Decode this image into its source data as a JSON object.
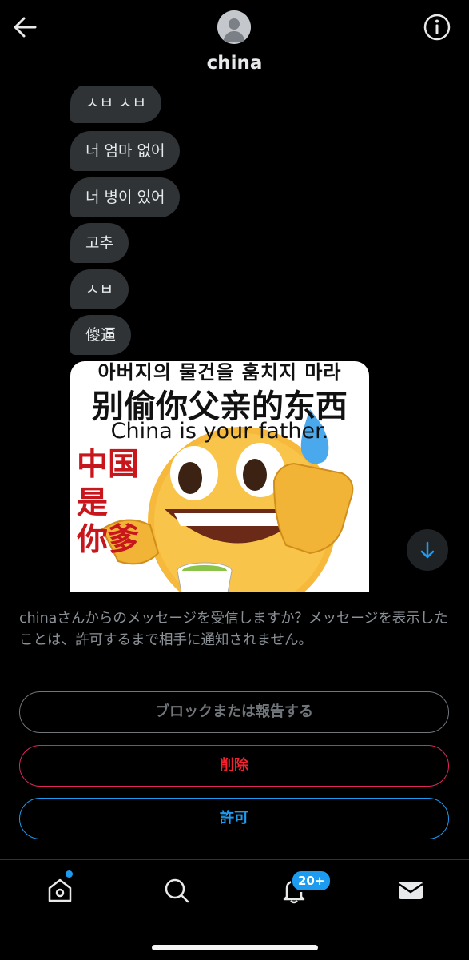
{
  "header": {
    "title": "china",
    "back_icon": "arrow-left-icon",
    "info_icon": "info-circle-icon",
    "avatar_icon": "default-avatar-icon"
  },
  "messages": [
    {
      "text": "ㅅㅂ ㅅㅂ"
    },
    {
      "text": "너 엄마 없어"
    },
    {
      "text": "너 병이 있어"
    },
    {
      "text": "고추"
    },
    {
      "text": "ㅅㅂ"
    },
    {
      "text": "傻逼"
    }
  ],
  "meme": {
    "line1": "아버지의 물건을 훔치지 마라",
    "line2": "别偷你父亲的东西",
    "line3": "China is your father.",
    "red_lines": [
      "中国",
      "是",
      "你爹"
    ]
  },
  "scroll_button_icon": "arrow-down-icon",
  "request": {
    "notice": "chinaさんからのメッセージを受信しますか？メッセージを表示したことは、許可するまで相手に通知されません。",
    "block_label": "ブロックまたは報告する",
    "delete_label": "削除",
    "allow_label": "許可"
  },
  "tabbar": {
    "home_icon": "home-icon",
    "search_icon": "search-icon",
    "notifications_icon": "bell-icon",
    "messages_icon": "mail-icon",
    "notifications_badge": "20+"
  },
  "colors": {
    "accent": "#1d9bf0",
    "danger": "#f4212e",
    "bubble": "#2f3336",
    "background": "#000000"
  }
}
